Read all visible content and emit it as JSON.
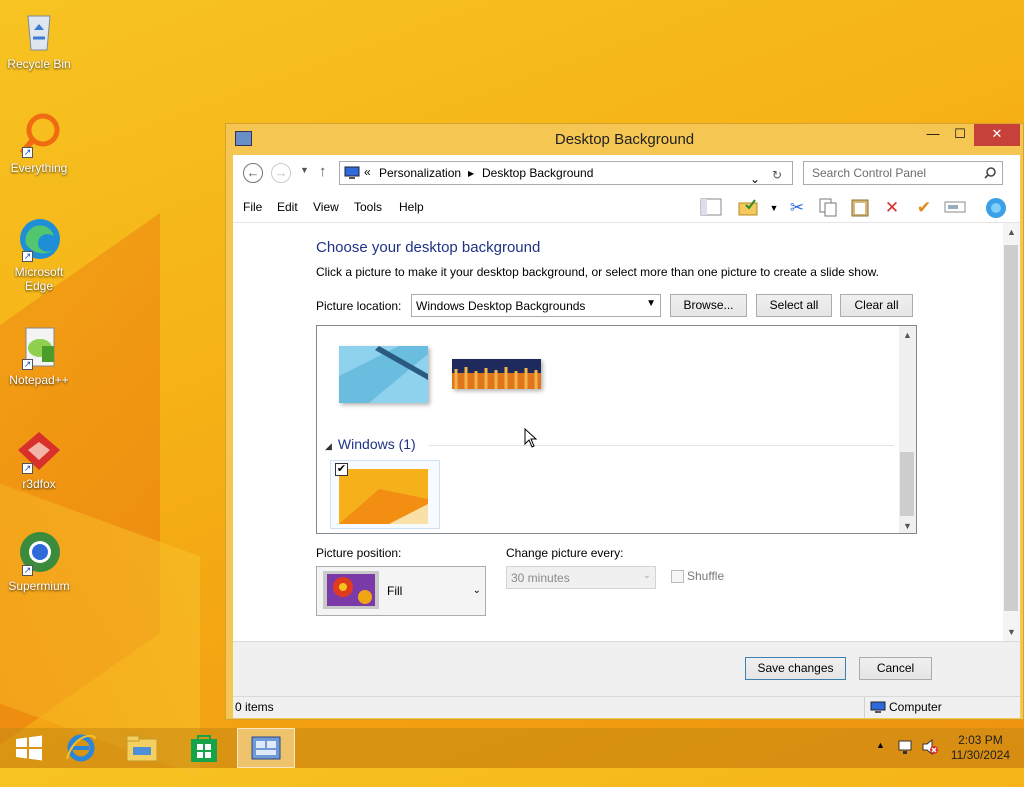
{
  "desktop": {
    "icons": [
      {
        "label": "Recycle Bin",
        "icon": "recycle-bin-icon"
      },
      {
        "label": "Everything",
        "icon": "everything-search-icon"
      },
      {
        "label": "Microsoft Edge",
        "icon": "edge-icon"
      },
      {
        "label": "Notepad++",
        "icon": "notepad-plus-plus-icon"
      },
      {
        "label": "r3dfox",
        "icon": "r3dfox-icon"
      },
      {
        "label": "Supermium",
        "icon": "supermium-icon"
      }
    ]
  },
  "window": {
    "title": "Desktop Background",
    "controls": {
      "minimize": "—",
      "maximize": "☐",
      "close": "✕"
    }
  },
  "address": {
    "prefix": "«",
    "crumbs": [
      "Personalization",
      "Desktop Background"
    ],
    "search_placeholder": "Search Control Panel"
  },
  "menu": [
    "File",
    "Edit",
    "View",
    "Tools",
    "Help"
  ],
  "page": {
    "heading": "Choose your desktop background",
    "description": "Click a picture to make it your desktop background, or select more than one picture to create a slide show.",
    "picture_location_label": "Picture location:",
    "picture_location_value": "Windows Desktop Backgrounds",
    "browse_label": "Browse...",
    "select_all_label": "Select all",
    "clear_all_label": "Clear all",
    "group_label": "Windows (1)",
    "picture_position_label": "Picture position:",
    "picture_position_value": "Fill",
    "change_every_label": "Change picture every:",
    "change_every_value": "30 minutes",
    "shuffle_label": "Shuffle",
    "save_label": "Save changes",
    "cancel_label": "Cancel"
  },
  "status": {
    "items": "0 items",
    "location": "Computer"
  },
  "taskbar": {
    "time": "2:03 PM",
    "date": "11/30/2024"
  },
  "colors": {
    "accent": "#1e3287",
    "desktop": "#f6b417",
    "close": "#c7413a"
  }
}
